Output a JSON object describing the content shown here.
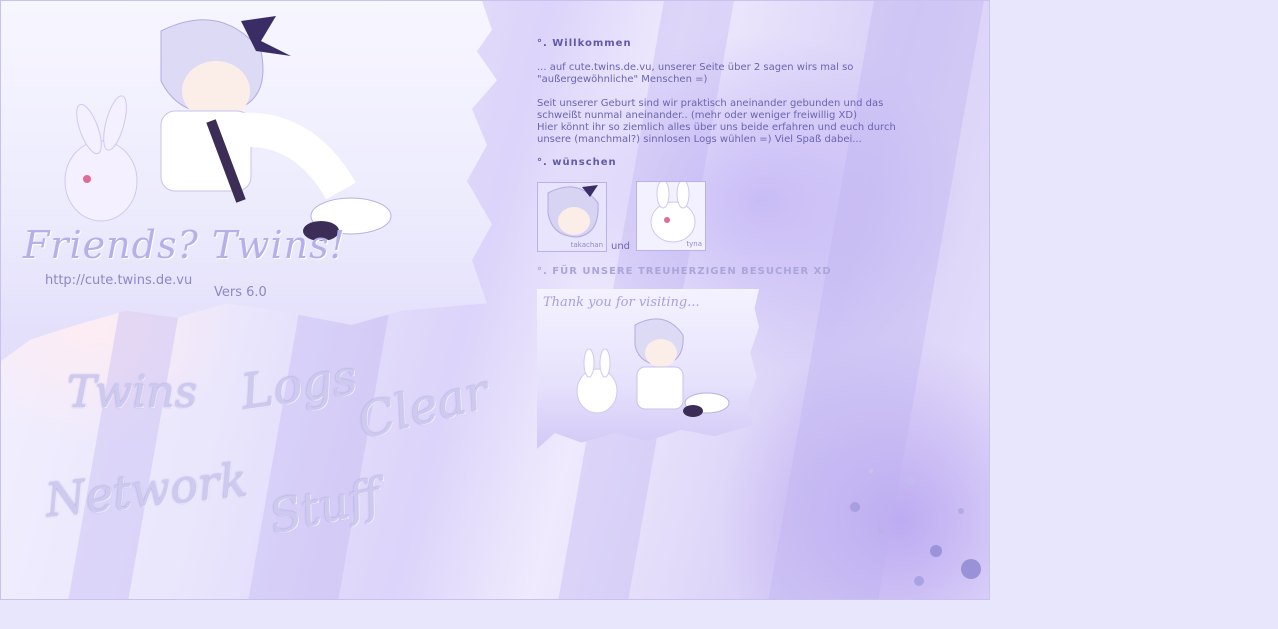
{
  "site": {
    "logo_text": "Friends? Twins!",
    "url": "http://cute.twins.de.vu",
    "version": "Vers 6.0"
  },
  "nav": {
    "twins": "Twins",
    "logs": "Logs",
    "clear": "Clear",
    "network": "Network",
    "stuff": "Stuff"
  },
  "welcome": {
    "heading": "°. Willkommen",
    "intro_line1": "... auf cute.twins.de.vu, unserer Seite über 2 sagen wirs mal so",
    "intro_line2": "\"außergewöhnliche\" Menschen =)",
    "body_line1": "Seit unserer Geburt sind wir praktisch aneinander gebunden und das",
    "body_line2": "schweißt nunmal aneinander.. (mehr oder weniger freiwillig XD)",
    "body_line3": "Hier könnt ihr so ziemlich alles über uns beide erfahren und euch durch",
    "body_line4": "unsere (manchmal?) sinnlosen Logs wühlen =) Viel Spaß dabei..."
  },
  "wishes": {
    "heading": "°. wünschen",
    "thumb1_label": "takachan",
    "connector": "und",
    "thumb2_label": "tyna"
  },
  "visitors": {
    "heading": "°. FÜR UNSERE TREUHERZIGEN BESUCHER XD",
    "banner_text": "Thank you for visiting..."
  },
  "colors": {
    "page_bg": "#e8e6fc",
    "accent": "#605aa8"
  }
}
